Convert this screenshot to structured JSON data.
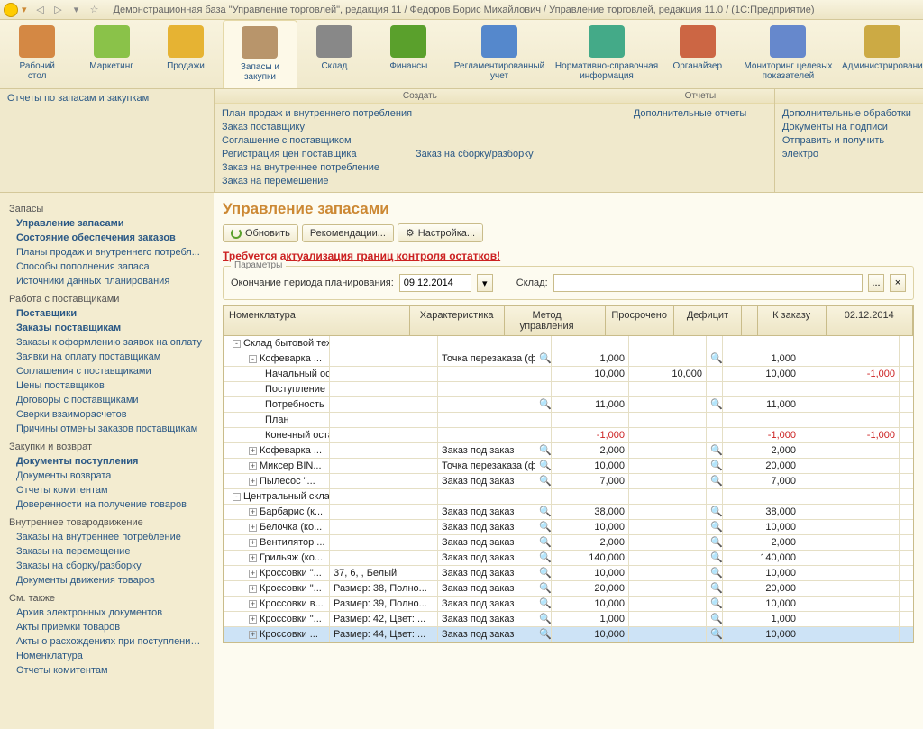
{
  "title": "Демонстрационная база \"Управление торговлей\", редакция 11 / Федоров Борис Михайлович / Управление торговлей, редакция 11.0 / (1С:Предприятие)",
  "ribbon": [
    {
      "label": "Рабочий\nстол"
    },
    {
      "label": "Маркетинг"
    },
    {
      "label": "Продажи"
    },
    {
      "label": "Запасы и\nзакупки",
      "active": true
    },
    {
      "label": "Склад"
    },
    {
      "label": "Финансы"
    },
    {
      "label": "Регламентированный\nучет",
      "wide": true
    },
    {
      "label": "Нормативно-справочная\nинформация",
      "wide": true
    },
    {
      "label": "Органайзер"
    },
    {
      "label": "Мониторинг целевых\nпоказателей",
      "wide": true
    },
    {
      "label": "Администрирование"
    }
  ],
  "secondary": {
    "reports_link": "Отчеты по запасам и закупкам",
    "create_hdr": "Создать",
    "create_cols": [
      [
        "План продаж и внутреннего потребления",
        "Заказ поставщику",
        "Соглашение с поставщиком"
      ],
      [
        "Регистрация цен поставщика",
        "Заказ на внутреннее потребление",
        "Заказ на перемещение"
      ],
      [
        "Заказ на сборку/разборку"
      ]
    ],
    "reports_hdr": "Отчеты",
    "reports": [
      "Дополнительные отчеты"
    ],
    "service": [
      "Дополнительные обработки",
      "Документы на подписи",
      "Отправить и получить электро"
    ]
  },
  "sidebar": [
    {
      "group": "Запасы",
      "items": [
        {
          "t": "Управление запасами",
          "b": true
        },
        {
          "t": "Состояние обеспечения заказов",
          "b": true
        },
        {
          "t": "Планы продаж и внутреннего потребл..."
        },
        {
          "t": "Способы пополнения запаса"
        },
        {
          "t": "Источники данных планирования"
        }
      ]
    },
    {
      "group": "Работа с поставщиками",
      "items": [
        {
          "t": "Поставщики",
          "b": true
        },
        {
          "t": "Заказы поставщикам",
          "b": true
        },
        {
          "t": "Заказы к оформлению заявок на оплату"
        },
        {
          "t": "Заявки на оплату поставщикам"
        },
        {
          "t": "Соглашения с поставщиками"
        },
        {
          "t": "Цены поставщиков"
        },
        {
          "t": "Договоры с поставщиками"
        },
        {
          "t": "Сверки взаиморасчетов"
        },
        {
          "t": "Причины отмены заказов поставщикам"
        }
      ]
    },
    {
      "group": "Закупки и возврат",
      "items": [
        {
          "t": "Документы поступления",
          "b": true
        },
        {
          "t": "Документы возврата"
        },
        {
          "t": "Отчеты комитентам"
        },
        {
          "t": "Доверенности на получение товаров"
        }
      ]
    },
    {
      "group": "Внутреннее товародвижение",
      "items": [
        {
          "t": "Заказы на внутреннее потребление"
        },
        {
          "t": "Заказы на перемещение"
        },
        {
          "t": "Заказы на сборку/разборку"
        },
        {
          "t": "Документы движения товаров"
        }
      ]
    },
    {
      "group": "См. также",
      "items": [
        {
          "t": "Архив электронных документов"
        },
        {
          "t": "Акты приемки товаров"
        },
        {
          "t": "Акты о расхождениях при поступлении т..."
        },
        {
          "t": "Номенклатура"
        },
        {
          "t": "Отчеты комитентам"
        }
      ]
    }
  ],
  "page": {
    "title": "Управление запасами",
    "btn_refresh": "Обновить",
    "btn_recom": "Рекомендации...",
    "btn_settings": "Настройка...",
    "warn": "Требуется актуализация границ контроля остатков!",
    "params_legend": "Параметры",
    "lbl_period": "Окончание периода планирования:",
    "val_period": "09.12.2014",
    "lbl_warehouse": "Склад:"
  },
  "grid": {
    "headers": {
      "name": "Номенклатура",
      "chr": "Характеристика",
      "meth": "Метод управления",
      "over": "Просрочено",
      "def": "Дефицит",
      "ord": "К заказу",
      "date": "02.12.2014"
    },
    "rows": [
      {
        "ind": 1,
        "tg": "-",
        "name": "Склад бытовой техники"
      },
      {
        "ind": 2,
        "tg": "-",
        "name": "Кофеварка ...",
        "meth": "Точка перезаказа (фи...",
        "q": true,
        "over": "1,000",
        "q2": true,
        "ord": "1,000"
      },
      {
        "ind": 3,
        "name": "Начальный остаток",
        "over": "10,000",
        "def": "10,000",
        "ord": "10,000",
        "date": "-1,000",
        "datered": true
      },
      {
        "ind": 3,
        "name": "Поступление"
      },
      {
        "ind": 3,
        "name": "Потребность",
        "q": true,
        "over": "11,000",
        "q2": true,
        "ord": "11,000"
      },
      {
        "ind": 3,
        "name": "План"
      },
      {
        "ind": 3,
        "name": "Конечный остаток",
        "over": "-1,000",
        "overred": true,
        "ord": "-1,000",
        "ordred": true,
        "date": "-1,000",
        "datered": true
      },
      {
        "ind": 2,
        "tg": "+",
        "name": "Кофеварка ...",
        "meth": "Заказ под заказ",
        "q": true,
        "over": "2,000",
        "q2": true,
        "ord": "2,000"
      },
      {
        "ind": 2,
        "tg": "+",
        "name": "Миксер BIN...",
        "meth": "Точка перезаказа (фи...",
        "q": true,
        "over": "10,000",
        "q2": true,
        "ord": "20,000"
      },
      {
        "ind": 2,
        "tg": "+",
        "name": "Пылесос \"...",
        "meth": "Заказ под заказ",
        "q": true,
        "over": "7,000",
        "q2": true,
        "ord": "7,000"
      },
      {
        "ind": 1,
        "tg": "-",
        "name": "Центральный склад"
      },
      {
        "ind": 2,
        "tg": "+",
        "name": "Барбарис (к...",
        "meth": "Заказ под заказ",
        "q": true,
        "over": "38,000",
        "q2": true,
        "ord": "38,000"
      },
      {
        "ind": 2,
        "tg": "+",
        "name": "Белочка (ко...",
        "meth": "Заказ под заказ",
        "q": true,
        "over": "10,000",
        "q2": true,
        "ord": "10,000"
      },
      {
        "ind": 2,
        "tg": "+",
        "name": "Вентилятор ...",
        "meth": "Заказ под заказ",
        "q": true,
        "over": "2,000",
        "q2": true,
        "ord": "2,000"
      },
      {
        "ind": 2,
        "tg": "+",
        "name": "Грильяж (ко...",
        "meth": "Заказ под заказ",
        "q": true,
        "over": "140,000",
        "q2": true,
        "ord": "140,000"
      },
      {
        "ind": 2,
        "tg": "+",
        "name": "Кроссовки \"...",
        "chr": "37, 6, , Белый",
        "meth": "Заказ под заказ",
        "q": true,
        "over": "10,000",
        "q2": true,
        "ord": "10,000"
      },
      {
        "ind": 2,
        "tg": "+",
        "name": "Кроссовки \"...",
        "chr": "Размер: 38, Полно...",
        "meth": "Заказ под заказ",
        "q": true,
        "over": "20,000",
        "q2": true,
        "ord": "20,000"
      },
      {
        "ind": 2,
        "tg": "+",
        "name": "Кроссовки в...",
        "chr": "Размер: 39, Полно...",
        "meth": "Заказ под заказ",
        "q": true,
        "over": "10,000",
        "q2": true,
        "ord": "10,000"
      },
      {
        "ind": 2,
        "tg": "+",
        "name": "Кроссовки \"...",
        "chr": "Размер: 42, Цвет: ...",
        "meth": "Заказ под заказ",
        "q": true,
        "over": "1,000",
        "q2": true,
        "ord": "1,000"
      },
      {
        "ind": 2,
        "tg": "+",
        "name": "Кроссовки ...",
        "chr": "Размер: 44, Цвет: ...",
        "meth": "Заказ под заказ",
        "q": true,
        "over": "10,000",
        "q2": true,
        "ord": "10,000",
        "sel": true
      }
    ]
  },
  "icons": {
    "back": "◁",
    "fwd": "▷",
    "down": "▾",
    "star": "☆",
    "x": "×",
    "dots": "...",
    "mag": "🔍"
  }
}
